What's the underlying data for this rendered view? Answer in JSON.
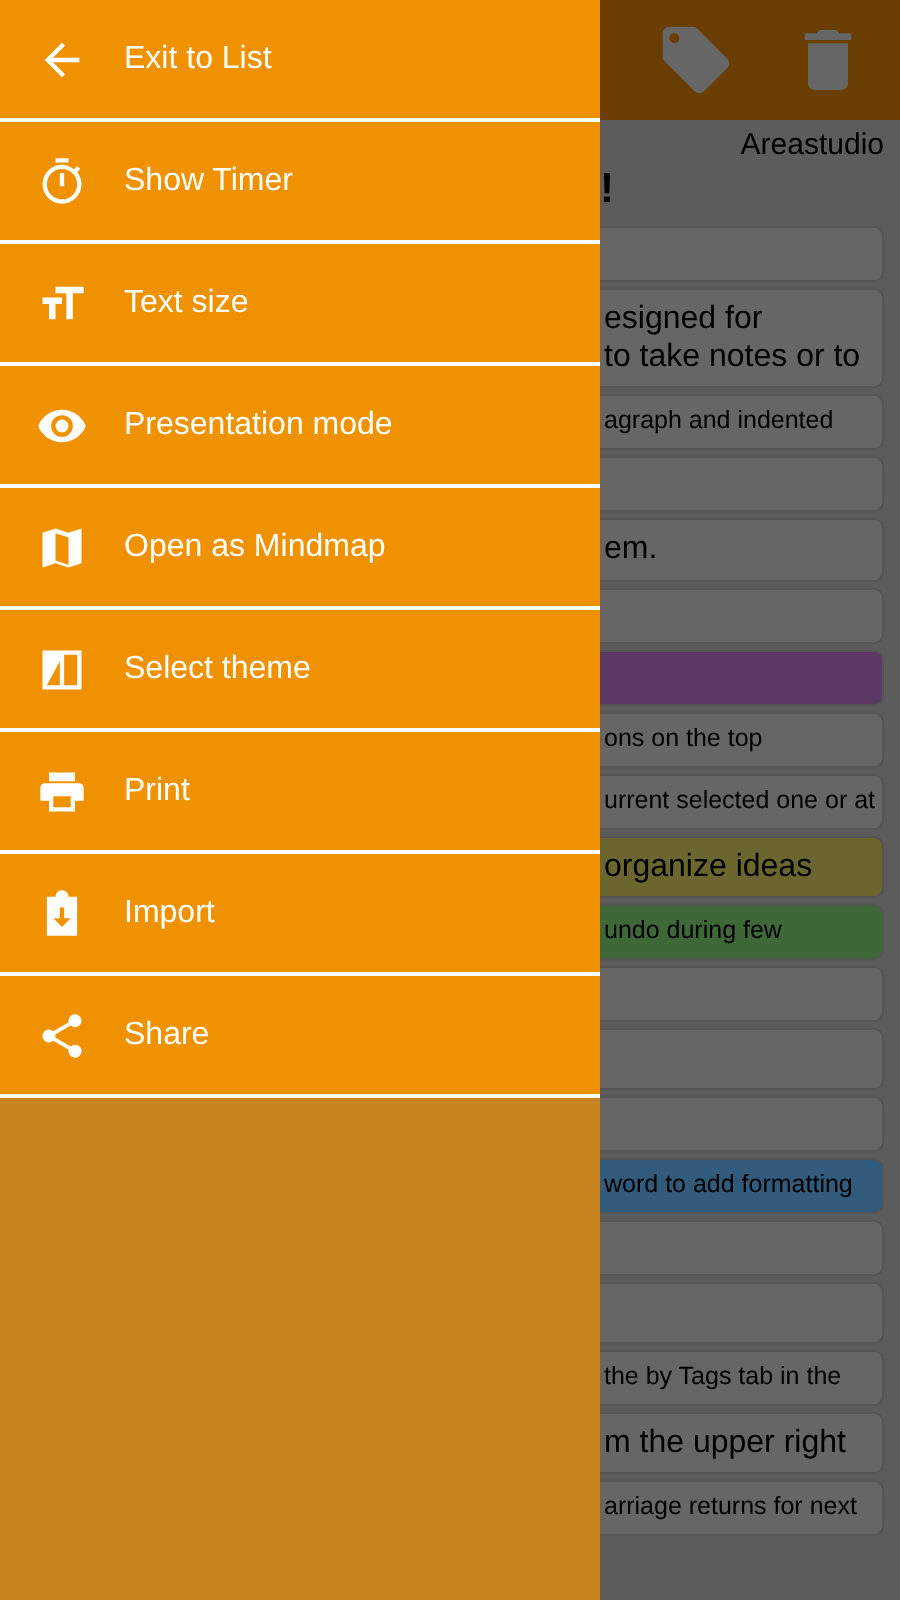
{
  "note": {
    "author": "Areastudio",
    "title": "!",
    "items": [
      {
        "children": [
          {
            "lines": [
              "esigned for",
              "to take notes or to"
            ],
            "children": [
              {
                "lines": [
                  "agraph and indented"
                ]
              }
            ]
          }
        ]
      },
      {
        "children": [
          {
            "lines": [
              "em."
            ],
            "children": [
              {
                "color": "#666666"
              },
              {
                "color": "#5e3864"
              },
              {
                "lines": [
                  "ons on the top"
                ],
                "children": [
                  {
                    "lines": [
                      "urrent selected one or at"
                    ]
                  }
                ]
              }
            ]
          },
          {
            "lines": [
              "organize ideas"
            ],
            "color": "#6b6630",
            "children": [
              {
                "lines": [
                  "undo during few"
                ],
                "color": "#3e6838"
              }
            ]
          }
        ]
      },
      {
        "children": [
          {
            "children": [
              {
                "children": [
                  {
                    "lines": [
                      "word to add formatting"
                    ],
                    "color": "#325a7a"
                  }
                ]
              }
            ]
          }
        ]
      },
      {
        "children": [
          {
            "children": [
              {
                "lines": [
                  "the by Tags tab in the"
                ]
              }
            ]
          },
          {
            "lines": [
              "m the upper right"
            ],
            "children": [
              {
                "lines": [
                  "arriage returns for next"
                ]
              }
            ]
          }
        ]
      }
    ]
  },
  "drawer": {
    "items": [
      {
        "kind": "exit",
        "label": "Exit to List"
      },
      {
        "kind": "timer",
        "label": "Show Timer"
      },
      {
        "kind": "textsize",
        "label": "Text size"
      },
      {
        "kind": "presentation",
        "label": "Presentation mode"
      },
      {
        "kind": "mindmap",
        "label": "Open as Mindmap"
      },
      {
        "kind": "theme",
        "label": "Select theme"
      },
      {
        "kind": "print",
        "label": "Print"
      },
      {
        "kind": "import",
        "label": "Import"
      },
      {
        "kind": "share",
        "label": "Share"
      }
    ]
  }
}
